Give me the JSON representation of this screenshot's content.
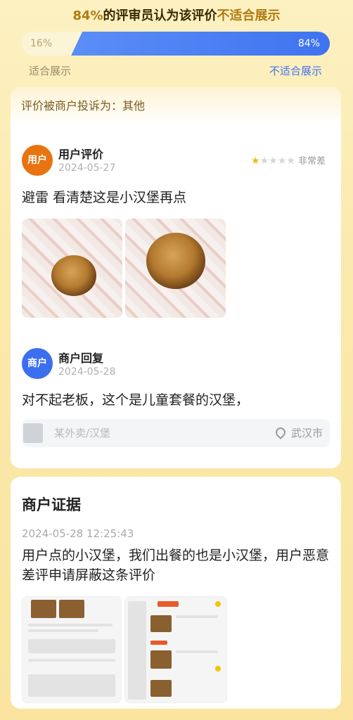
{
  "header": {
    "headline_pct": "84%",
    "headline_mid": "的评审员认为该评价",
    "headline_verdict": "不适合展示",
    "vote": {
      "left_pct": "16%",
      "right_pct": "84%",
      "left_fraction": 0.16,
      "right_fraction": 0.84,
      "left_label": "适合展示",
      "right_label": "不适合展示"
    }
  },
  "review_card": {
    "complaint": "评价被商户投诉为：其他",
    "user_review": {
      "avatar_text": "用户",
      "title": "用户评价",
      "date": "2024-05-27",
      "stars": 1,
      "stars_max": 5,
      "rating_text": "非常差",
      "content": "避雷 看清楚这是小汉堡再点"
    },
    "merchant_reply": {
      "avatar_text": "商户",
      "title": "商户回复",
      "date": "2024-05-28",
      "content": "对不起老板，这个是儿童套餐的汉堡，"
    },
    "location": {
      "shop": "某外卖/汉堡",
      "city": "武汉市"
    }
  },
  "evidence_card": {
    "title": "商户证据",
    "time": "2024-05-28 12:25:43",
    "text": "用户点的小汉堡，我们出餐的也是小汉堡，用户恶意差评申请屏蔽这条评价"
  }
}
